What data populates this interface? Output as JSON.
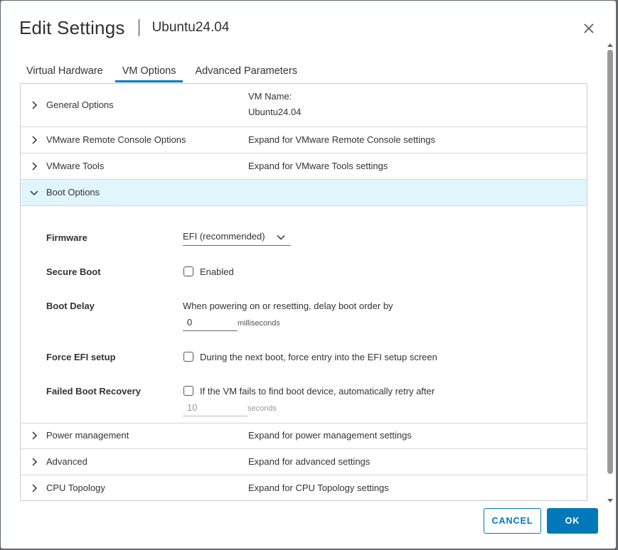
{
  "dialog": {
    "title": "Edit Settings",
    "subtitle": "Ubuntu24.04",
    "close_icon": "close-icon"
  },
  "tabs": [
    {
      "label": "Virtual Hardware",
      "active": false
    },
    {
      "label": "VM Options",
      "active": true
    },
    {
      "label": "Advanced Parameters",
      "active": false
    }
  ],
  "sections": {
    "general": {
      "label": "General Options",
      "value_line1": "VM Name:",
      "value_line2": "Ubuntu24.04"
    },
    "vmrc": {
      "label": "VMware Remote Console Options",
      "value": "Expand for VMware Remote Console settings"
    },
    "tools": {
      "label": "VMware Tools",
      "value": "Expand for VMware Tools settings"
    },
    "boot": {
      "label": "Boot Options",
      "expanded": true
    },
    "power": {
      "label": "Power management",
      "value": "Expand for power management settings"
    },
    "advanced": {
      "label": "Advanced",
      "value": "Expand for advanced settings"
    },
    "cpu": {
      "label": "CPU Topology",
      "value": "Expand for CPU Topology settings"
    }
  },
  "boot_options": {
    "firmware": {
      "label": "Firmware",
      "selected": "EFI (recommended)"
    },
    "secure_boot": {
      "label": "Secure Boot",
      "checkbox_label": "Enabled",
      "checked": false
    },
    "boot_delay": {
      "label": "Boot Delay",
      "description": "When powering on or resetting, delay boot order by",
      "value": "0",
      "unit": "milliseconds"
    },
    "force_efi": {
      "label": "Force EFI setup",
      "checkbox_label": "During the next boot, force entry into the EFI setup screen",
      "checked": false
    },
    "failed_recovery": {
      "label": "Failed Boot Recovery",
      "checkbox_label": "If the VM fails to find boot device, automatically retry after",
      "checked": false,
      "value": "10",
      "unit": "seconds"
    }
  },
  "footer": {
    "cancel_label": "CANCEL",
    "ok_label": "OK"
  },
  "colors": {
    "accent": "#0079b8",
    "expanded_row_bg": "#e1f5fd"
  }
}
